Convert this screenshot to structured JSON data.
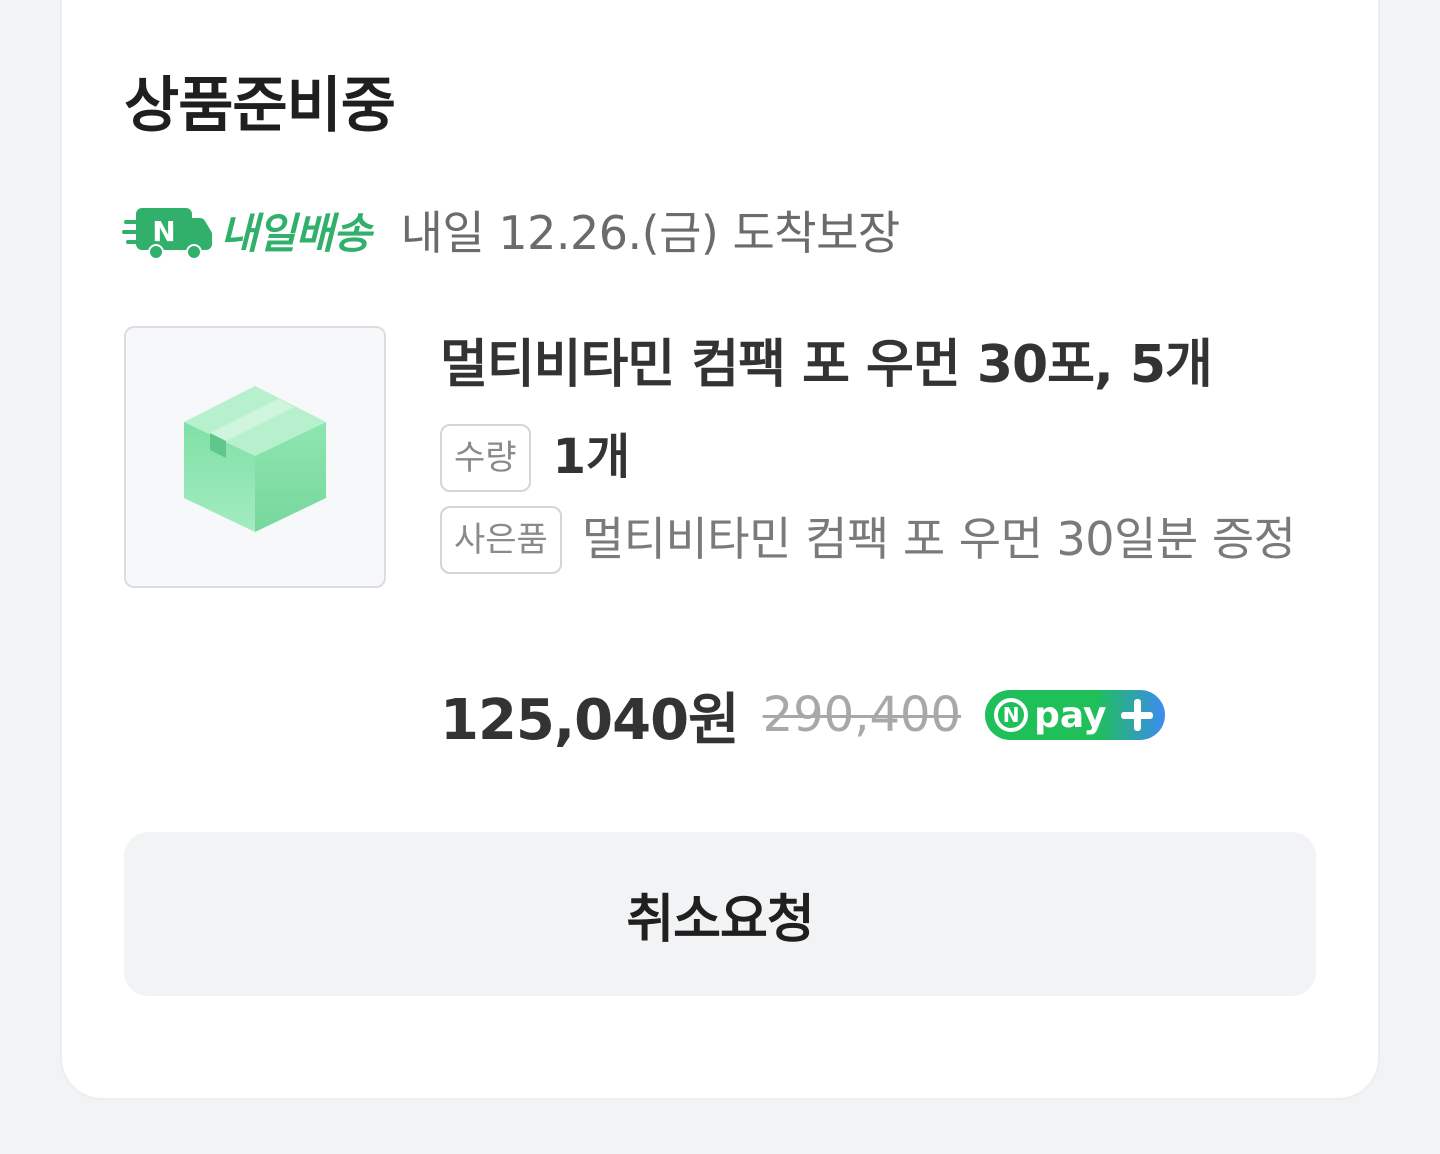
{
  "order": {
    "status": "상품준비중",
    "delivery": {
      "badge_letter": "N",
      "brand": "내일배송",
      "message": "내일 12.26.(금) 도착보장",
      "brand_color": "#30b06a"
    },
    "product": {
      "image_icon": "box-icon",
      "name": "멀티비타민 컴팩 포 우먼 30포, 5개",
      "quantity_label": "수량",
      "quantity_value": "1개",
      "gift_label": "사은품",
      "gift_value": "멀티비타민 컴팩 포 우먼 30일분 증정",
      "price": "125,040원",
      "original_price": "290,400",
      "pay_badge": {
        "letter": "N",
        "text": "pay",
        "icon": "plus-icon"
      }
    },
    "cancel_label": "취소요청"
  }
}
